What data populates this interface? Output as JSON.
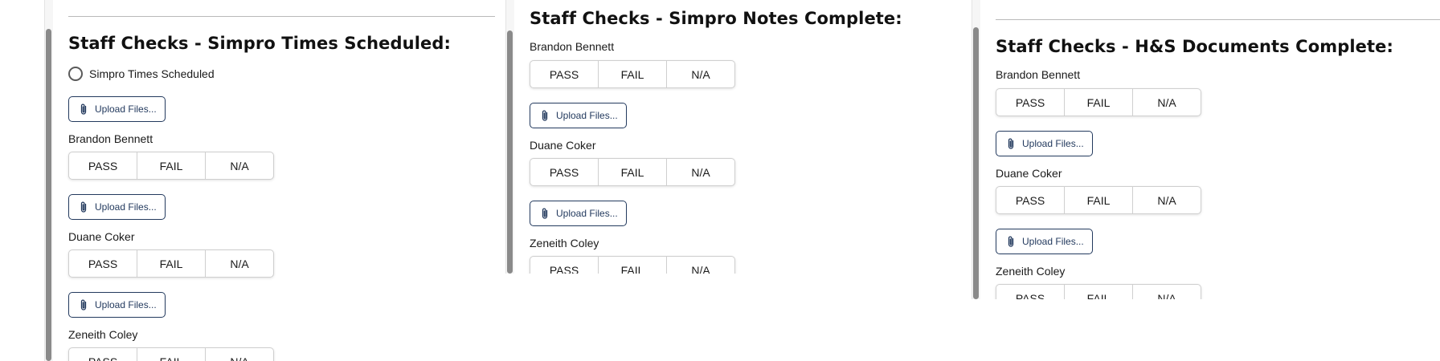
{
  "upload_label": "Upload Files...",
  "pass_label": "PASS",
  "fail_label": "FAIL",
  "na_label": "N/A",
  "staff": [
    "Brandon Bennett",
    "Duane Coker",
    "Zeneith Coley"
  ],
  "panels": [
    {
      "title": "Staff Checks - Simpro Times Scheduled:",
      "radio_label": "Simpro Times Scheduled"
    },
    {
      "title": "Staff Checks - Simpro Notes Complete:"
    },
    {
      "title": "Staff Checks - H&S Documents Complete:"
    }
  ],
  "colors": {
    "upload_border": "#233a5e",
    "scroll_thumb": "#8a8a8a"
  }
}
